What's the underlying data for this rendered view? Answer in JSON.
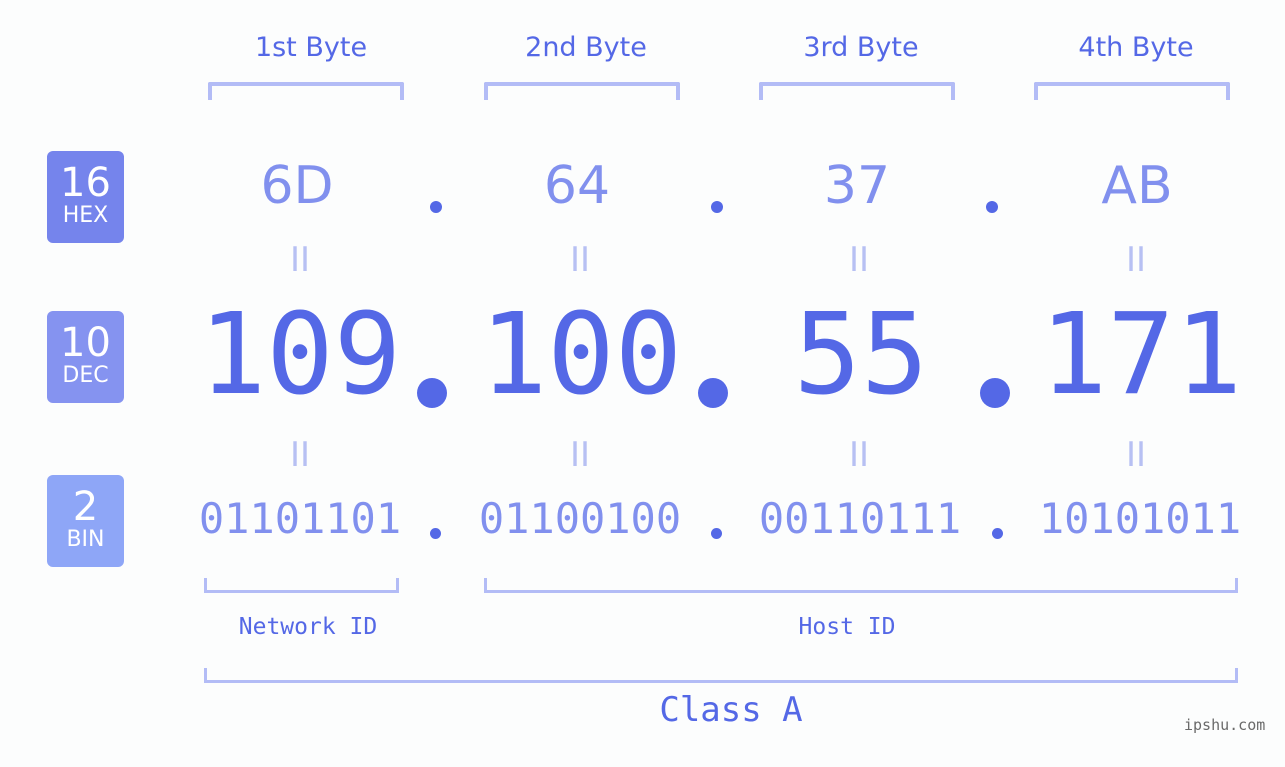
{
  "bytes": [
    {
      "label": "1st Byte",
      "hex": "6D",
      "dec": "109",
      "bin": "01101101"
    },
    {
      "label": "2nd Byte",
      "hex": "64",
      "dec": "100",
      "bin": "01100100"
    },
    {
      "label": "3rd Byte",
      "hex": "37",
      "dec": "55",
      "bin": "00110111"
    },
    {
      "label": "4th Byte",
      "hex": "AB",
      "dec": "171",
      "bin": "10101011"
    }
  ],
  "bases": {
    "hex": {
      "num": "16",
      "label": "HEX",
      "color": "#7584ec"
    },
    "dec": {
      "num": "10",
      "label": "DEC",
      "color": "#8593f0"
    },
    "bin": {
      "num": "2",
      "label": "BIN",
      "color": "#8ea6f7"
    }
  },
  "equals_symbol": "II",
  "network_id_label": "Network ID",
  "host_id_label": "Host ID",
  "class_label": "Class A",
  "watermark": "ipshu.com",
  "colors": {
    "primary": "#5468e6",
    "secondary": "#8190ee",
    "bracket": "#b3bcf6",
    "background": "#fcfdfd"
  }
}
